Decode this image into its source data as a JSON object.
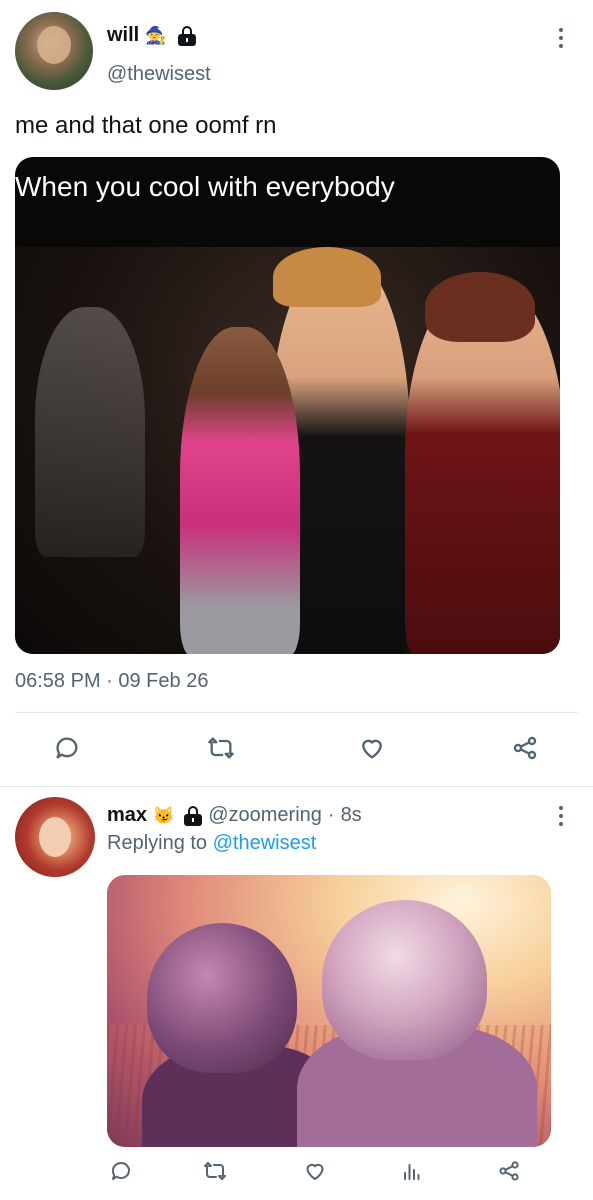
{
  "main_tweet": {
    "display_name": "will",
    "name_emoji": "🧙",
    "handle": "@thewisest",
    "text": "me and that one oomf rn",
    "media_caption": "When you cool with everybody",
    "timestamp": "06:58 PM · 09 Feb 26",
    "actions": [
      "reply-icon",
      "retweet-icon",
      "like-icon",
      "share-icon"
    ]
  },
  "reply_tweet": {
    "display_name": "max",
    "name_emoji": "😼",
    "handle": "@zoomering",
    "separator": "·",
    "time_ago": "8s",
    "replying_prefix": "Replying to",
    "replying_to": "@thewisest",
    "actions": [
      "reply-icon",
      "retweet-icon",
      "like-icon",
      "views-icon",
      "share-icon"
    ]
  },
  "colors": {
    "text": "#0f1419",
    "secondary": "#536471",
    "link": "#1d9bf0",
    "divider": "#e1e8ed"
  }
}
